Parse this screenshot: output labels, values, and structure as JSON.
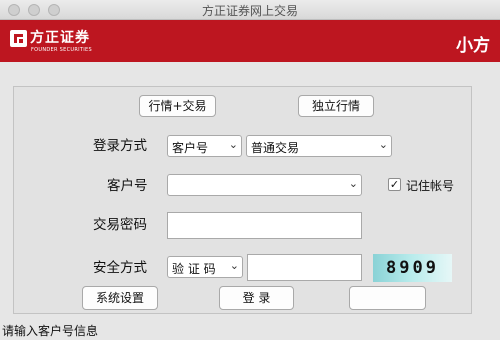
{
  "window": {
    "title": "方正证券网上交易"
  },
  "banner": {
    "logo_cn": "方正证券",
    "logo_en": "FOUNDER SECURITIES",
    "brand_right": "小方",
    "color": "#bd1620"
  },
  "top_buttons": {
    "quote_trade": "行情+交易",
    "quote_only": "独立行情"
  },
  "login_method": {
    "label": "登录方式",
    "account_type": "客户号",
    "trade_type": "普通交易"
  },
  "account": {
    "label": "客户号",
    "value": "",
    "remember_label": "记住帐号",
    "remember_checked": true
  },
  "password": {
    "label": "交易密码",
    "value": ""
  },
  "security": {
    "label": "安全方式",
    "method": "验 证 码",
    "code_input": "",
    "captcha_text": "8909"
  },
  "bottom_buttons": {
    "settings": "系统设置",
    "login": "登 录",
    "third": ""
  },
  "status_text": "请输入客户号信息"
}
